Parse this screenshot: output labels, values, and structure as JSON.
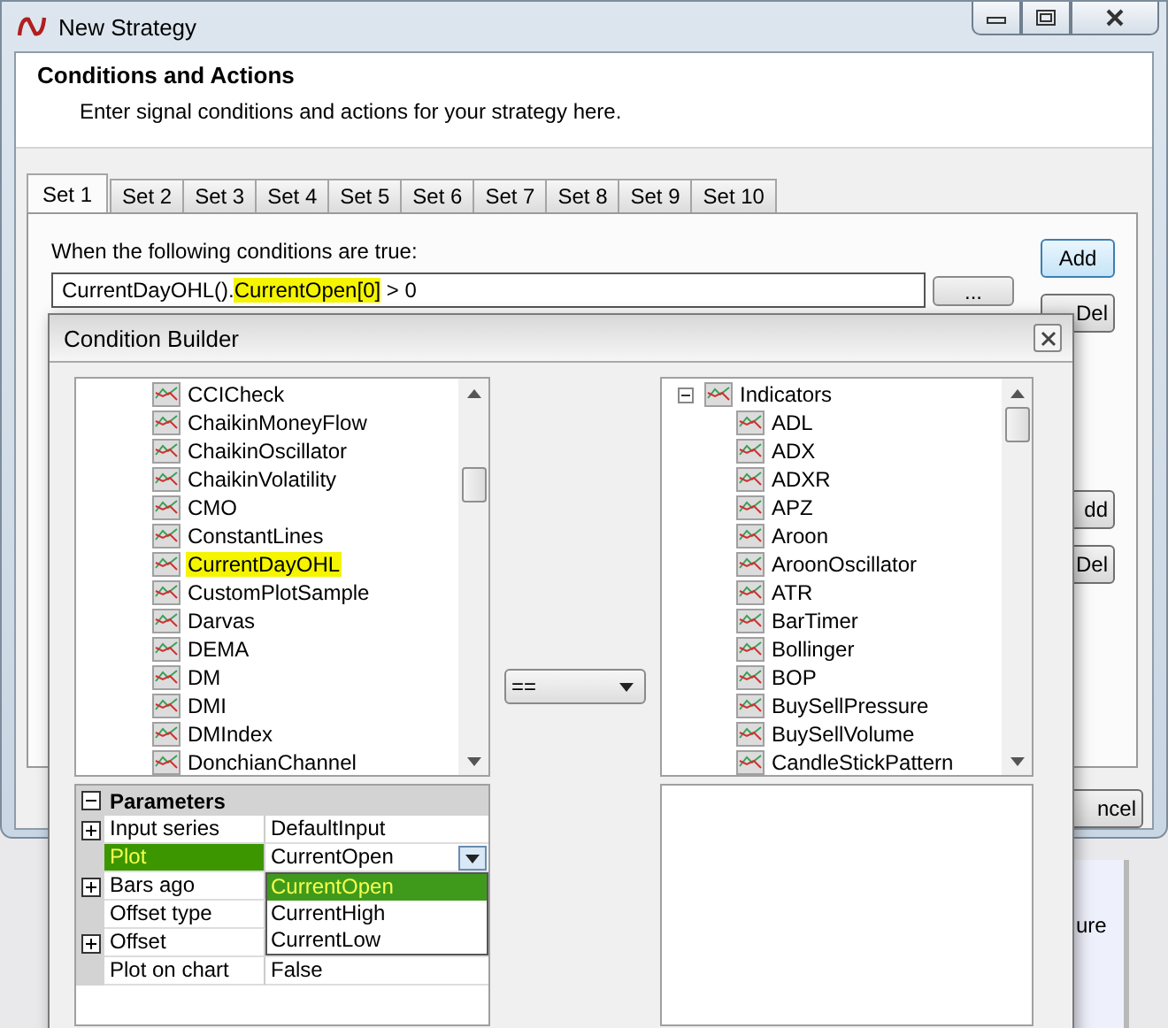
{
  "window": {
    "title": "New Strategy"
  },
  "header": {
    "title": "Conditions and Actions",
    "subtitle": "Enter signal conditions and actions for your strategy here."
  },
  "tabs": [
    {
      "label": "Set 1",
      "selected": true
    },
    {
      "label": "Set 2",
      "selected": false
    },
    {
      "label": "Set 3",
      "selected": false
    },
    {
      "label": "Set 4",
      "selected": false
    },
    {
      "label": "Set 5",
      "selected": false
    },
    {
      "label": "Set 6",
      "selected": false
    },
    {
      "label": "Set 7",
      "selected": false
    },
    {
      "label": "Set 8",
      "selected": false
    },
    {
      "label": "Set 9",
      "selected": false
    },
    {
      "label": "Set 10",
      "selected": false
    }
  ],
  "conditions": {
    "label": "When the following conditions are true:",
    "formula": [
      {
        "text": "CurrentDayOHL().",
        "highlighted": false
      },
      {
        "text": "CurrentOpen[0]",
        "highlighted": true
      },
      {
        "text": " > 0",
        "highlighted": false
      }
    ],
    "browse_button": "...",
    "add_button": "Add",
    "del_button": "Del"
  },
  "actions_buttons": [
    "dd",
    "Del"
  ],
  "cancel_button": "ncel",
  "background_text": "ure",
  "condition_builder": {
    "title": "Condition Builder",
    "left_tree": [
      {
        "label": "CCICheck",
        "highlighted": false
      },
      {
        "label": "ChaikinMoneyFlow",
        "highlighted": false
      },
      {
        "label": "ChaikinOscillator",
        "highlighted": false
      },
      {
        "label": "ChaikinVolatility",
        "highlighted": false
      },
      {
        "label": "CMO",
        "highlighted": false
      },
      {
        "label": "ConstantLines",
        "highlighted": false
      },
      {
        "label": "CurrentDayOHL",
        "highlighted": true
      },
      {
        "label": "CustomPlotSample",
        "highlighted": false
      },
      {
        "label": "Darvas",
        "highlighted": false
      },
      {
        "label": "DEMA",
        "highlighted": false
      },
      {
        "label": "DM",
        "highlighted": false
      },
      {
        "label": "DMI",
        "highlighted": false
      },
      {
        "label": "DMIndex",
        "highlighted": false
      },
      {
        "label": "DonchianChannel",
        "highlighted": false
      }
    ],
    "operator": "==",
    "right_tree": [
      {
        "label": "Indicators",
        "expanded": true,
        "children": [
          {
            "label": "ADL"
          },
          {
            "label": "ADX"
          },
          {
            "label": "ADXR"
          },
          {
            "label": "APZ"
          },
          {
            "label": "Aroon"
          },
          {
            "label": "AroonOscillator"
          },
          {
            "label": "ATR"
          },
          {
            "label": "BarTimer"
          },
          {
            "label": "Bollinger"
          },
          {
            "label": "BOP"
          },
          {
            "label": "BuySellPressure"
          },
          {
            "label": "BuySellVolume"
          },
          {
            "label": "CandleStickPattern"
          }
        ]
      }
    ],
    "parameters": {
      "title": "Parameters",
      "expanded": true,
      "rows": [
        {
          "label": "Input series",
          "value": "DefaultInput",
          "expandable": true,
          "selected": false
        },
        {
          "label": "Plot",
          "value": "CurrentOpen",
          "expandable": false,
          "selected": true
        },
        {
          "label": "Bars ago",
          "expandable": true,
          "selected": false
        },
        {
          "label": "Offset type",
          "expandable": false,
          "selected": false
        },
        {
          "label": "Offset",
          "expandable": true,
          "selected": false
        },
        {
          "label": "Plot on chart",
          "value": "False",
          "expandable": false,
          "selected": false
        }
      ]
    },
    "plot_dropdown": [
      {
        "label": "CurrentOpen",
        "selected": true
      },
      {
        "label": "CurrentHigh",
        "selected": false
      },
      {
        "label": "CurrentLow",
        "selected": false
      }
    ]
  }
}
